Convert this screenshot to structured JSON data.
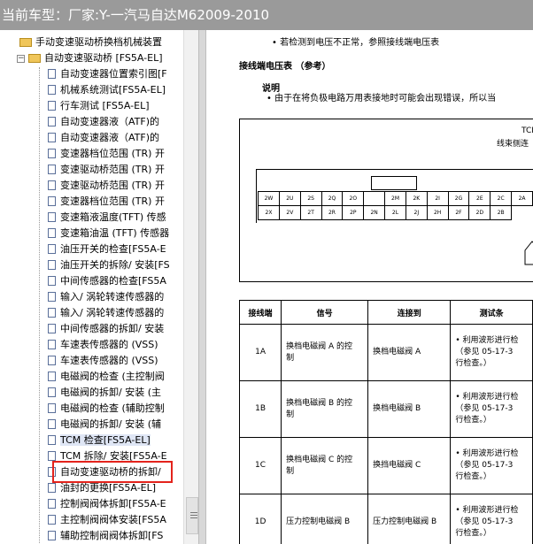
{
  "titlebar": {
    "text": "当前车型：厂家:Y-一汽马自达M62009-2010"
  },
  "tree": {
    "partial_top": "手动变速驱动桥换档机械装置",
    "open_folder": "自动变速驱动桥 [FS5A-EL]",
    "items": [
      "自动变速器位置索引图[F",
      "机械系统测试[FS5A-EL]",
      "行车测试 [FS5A-EL]",
      "自动变速器液（ATF)的",
      "自动变速器液（ATF)的",
      "变速器档位范围 (TR) 开",
      "变速驱动桥范围 (TR) 开",
      "变速驱动桥范围 (TR) 开",
      "变速器档位范围 (TR) 开",
      "变速箱液温度(TFT) 传感",
      "变速箱油温 (TFT) 传感器",
      "油压开关的检查[FS5A-E",
      "油压开关的拆除/ 安装[FS",
      "中间传感器的检查[FS5A",
      "输入/ 涡轮转速传感器的",
      "输入/ 涡轮转速传感器的",
      "中间传感器的拆卸/ 安装",
      "车速表传感器的 (VSS)",
      "车速表传感器的 (VSS)",
      "电磁阀的检查 (主控制阀",
      "电磁阀的拆卸/ 安装 (主",
      "电磁阀的检查 (辅助控制",
      "电磁阀的拆卸/ 安装 (辅",
      "TCM 检查[FS5A-EL]",
      "TCM 拆除/ 安装[FS5A-E",
      "自动变速驱动桥的拆卸/",
      "油封的更换[FS5A-EL]",
      "控制阀阀体拆卸[FS5A-E",
      "主控制阀阀体安装[FS5A",
      "辅助控制阀阀体拆卸[FS"
    ]
  },
  "document": {
    "top_text": "• 若检测到电压不正常，参照接线端电压表",
    "heading": "接线端电压表 （参考）",
    "note_title": "说明",
    "note_text": "• 由于在将负极电路万用表接地时可能会出现错误，所以当",
    "connector_label_1": "TCM",
    "connector_label_2": "线束侧连",
    "pins_row1": [
      "2W",
      "2U",
      "2S",
      "2Q",
      "2O",
      "",
      "2M",
      "2K",
      "2I",
      "2G",
      "2E",
      "2C",
      "2A"
    ],
    "pins_row2": [
      "2X",
      "2V",
      "2T",
      "2R",
      "2P",
      "2N",
      "2L",
      "2J",
      "2H",
      "2F",
      "2D",
      "2B"
    ],
    "table_headers": [
      "接线端",
      "信号",
      "连接到",
      "测试条"
    ],
    "table_rows": [
      {
        "terminal": "1A",
        "signal_1": "换档电磁阀 A 的控",
        "signal_2": "制",
        "connect": "换档电磁阀 A",
        "test_1": "• 利用波形进行检",
        "test_2": "（参见 05-17-3",
        "test_3": "行检查。）"
      },
      {
        "terminal": "1B",
        "signal_1": "换档电磁阀 B 的控",
        "signal_2": "制",
        "connect": "换档电磁阀 B",
        "test_1": "• 利用波形进行检",
        "test_2": "（参见 05-17-3",
        "test_3": "行检查。）"
      },
      {
        "terminal": "1C",
        "signal_1": "换档电磁阀 C 的控",
        "signal_2": "制",
        "connect": "换挡电磁阀 C",
        "test_1": "• 利用波形进行检",
        "test_2": "（参见 05-17-3",
        "test_3": "行检查。）"
      },
      {
        "terminal": "1D",
        "signal_1": "压力控制电磁阀 B",
        "signal_2": "",
        "connect": "压力控制电磁阀 B",
        "test_1": "• 利用波形进行检",
        "test_2": "（参见 05-17-3",
        "test_3": "行检查。）"
      }
    ]
  }
}
